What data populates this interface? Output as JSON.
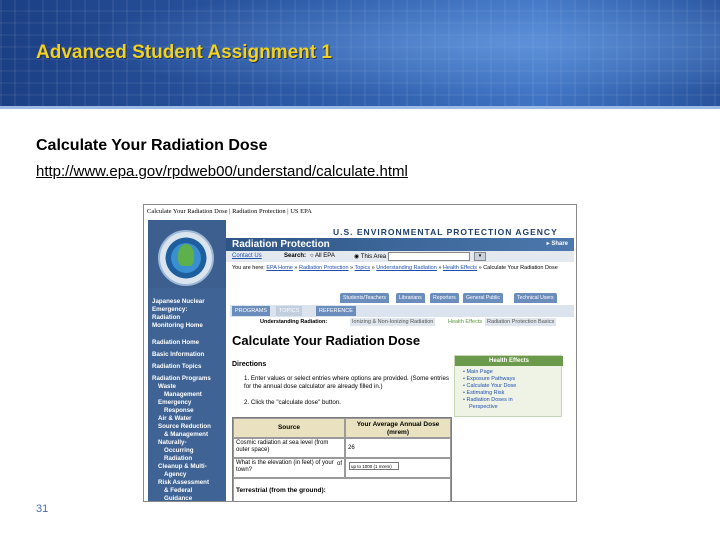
{
  "slide": {
    "title": "Advanced Student Assignment 1",
    "subtitle": "Calculate Your Radiation Dose",
    "url": "http://www.epa.gov/rpdweb00/understand/calculate.html",
    "page_number": "31"
  },
  "screenshot": {
    "browser_title": "Calculate Your Radiation Dose | Radiation Protection | US EPA",
    "agency": "U.S. ENVIRONMENTAL PROTECTION AGENCY",
    "section_title": "Radiation Protection",
    "share_label": "Share",
    "contact_us": "Contact Us",
    "search_label": "Search:",
    "search_all": "All EPA",
    "search_area": "This Area",
    "go_label": "Go",
    "breadcrumb_prefix": "You are here:",
    "breadcrumb": [
      "EPA Home",
      "Radiation Protection",
      "Topics",
      "Understanding Radiation",
      "Health Effects"
    ],
    "breadcrumb_current": "Calculate Your Radiation Dose",
    "leftnav": {
      "emergency_1": "Japanese Nuclear",
      "emergency_2": "Emergency:",
      "emergency_3": "Radiation",
      "emergency_4": "Monitoring Home",
      "items": [
        "Radiation Home",
        "Basic Information",
        "Radiation Topics",
        "Radiation Programs"
      ],
      "sub": [
        "Waste",
        "Management",
        "Emergency",
        "Response",
        "Air & Water",
        "Source Reduction",
        "& Management",
        "Naturally-",
        "Occurring",
        "Radiation",
        "Cleanup & Multi-",
        "Agency",
        "Risk Assessment",
        "& Federal",
        "Guidance"
      ]
    },
    "tabs": [
      "Students/Teachers",
      "Librarians",
      "Reporters",
      "General Public",
      "Technical Users"
    ],
    "subtabs": [
      "PROGRAMS",
      "TOPICS",
      "REFERENCE"
    ],
    "understanding_label": "Understanding Radiation:",
    "understanding_tabs": [
      "Ionizing & Non-Ionizing Radiation",
      "Health Effects",
      "Radiation Protection Basics"
    ],
    "page_heading": "Calculate Your Radiation Dose",
    "directions_heading": "Directions",
    "directions": [
      "1.  Enter values or select entries where options are provided. (Some entries for the annual dose calculator are already filled in.)",
      "2.  Click the \"calculate dose\" button."
    ],
    "health_effects": {
      "title": "Health Effects",
      "items": [
        "Main Page",
        "Exposure Pathways",
        "Calculate Your Dose",
        "Estimating Risk",
        "Radiation Doses in",
        "Perspective"
      ]
    },
    "table": {
      "col_source": "Source",
      "col_dose": "Your Average Annual Dose (mrem)",
      "row1_source": "Cosmic radiation at sea level (from outer space)",
      "row1_dose": "26",
      "row2_source": "What is the elevation (in feet) of your town?",
      "row2_input": "up to 1000 (1 mrem)",
      "of_label": "of",
      "terrestrial": "Terrestrial (from the ground):"
    }
  }
}
